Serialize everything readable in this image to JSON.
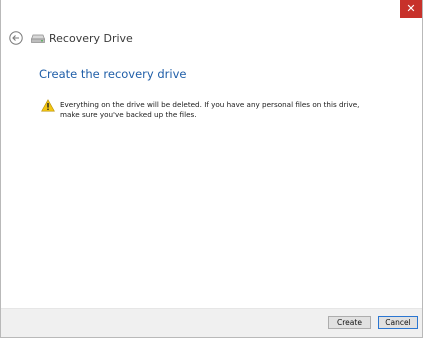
{
  "window": {
    "close_glyph": "✕"
  },
  "header": {
    "back_icon": "back-arrow-icon",
    "drive_icon": "drive-icon",
    "title": "Recovery Drive"
  },
  "main": {
    "heading": "Create the recovery drive",
    "warning_icon": "warning-icon",
    "warning_text": "Everything on the drive will be deleted. If you have any personal files on this drive, make sure you've backed up the files."
  },
  "footer": {
    "create_label": "Create",
    "cancel_label": "Cancel"
  },
  "colors": {
    "heading": "#1f5ea8",
    "close": "#c7312a",
    "warning": "#f2c511"
  }
}
